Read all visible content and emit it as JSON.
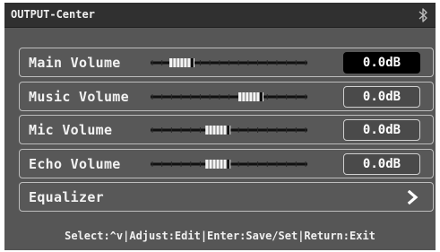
{
  "header": {
    "title": "OUTPUT-Center",
    "status_icon": "bluetooth-icon"
  },
  "rows": [
    {
      "label": "Main Volume",
      "value": "0.0dB",
      "slider_level": 0.2,
      "active": true
    },
    {
      "label": "Music Volume",
      "value": "0.0dB",
      "slider_level": 0.64,
      "active": false
    },
    {
      "label": "Mic Volume",
      "value": "0.0dB",
      "slider_level": 0.43,
      "active": false
    },
    {
      "label": "Echo Volume",
      "value": "0.0dB",
      "slider_level": 0.43,
      "active": false
    }
  ],
  "equalizer": {
    "label": "Equalizer",
    "icon": "chevron-right-icon"
  },
  "footer": {
    "hint": "Select:^v|Adjust:Edit|Enter:Save/Set|Return:Exit"
  },
  "colors": {
    "background": "#565656",
    "titlebar": "#303030",
    "active_value": "#000000",
    "text": "#f2f2f2"
  }
}
